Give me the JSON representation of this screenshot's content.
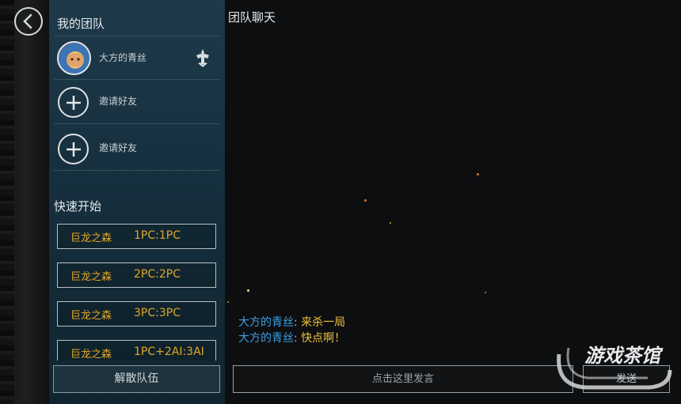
{
  "team_panel": {
    "title": "我的团队",
    "members": [
      {
        "name": "大方的青丝",
        "type": "player"
      },
      {
        "name": "邀请好友",
        "type": "invite"
      },
      {
        "name": "邀请好友",
        "type": "invite"
      }
    ]
  },
  "quick_start": {
    "title": "快速开始",
    "options": [
      {
        "map": "巨龙之森",
        "mode": "1PC:1PC"
      },
      {
        "map": "巨龙之森",
        "mode": "2PC:2PC"
      },
      {
        "map": "巨龙之森",
        "mode": "3PC:3PC"
      },
      {
        "map": "巨龙之森",
        "mode": "1PC+2AI:3AI"
      }
    ],
    "disband_label": "解散队伍"
  },
  "chat": {
    "title": "团队聊天",
    "messages": [
      {
        "sender": "大方的青丝",
        "sep": ": ",
        "text": "来杀一局"
      },
      {
        "sender": "大方的青丝",
        "sep": ": ",
        "text": "快点啊！"
      }
    ],
    "input_placeholder": "点击这里发言",
    "send_label": "发送"
  },
  "watermark": "游戏茶馆",
  "colors": {
    "panel_bg": "#17303f",
    "accent_orange": "#e3a72a",
    "sender_blue": "#3aa0e8"
  },
  "icons": {
    "back": "chevron-left-icon",
    "invite": "plus-icon",
    "leader": "leader-crest-icon"
  }
}
